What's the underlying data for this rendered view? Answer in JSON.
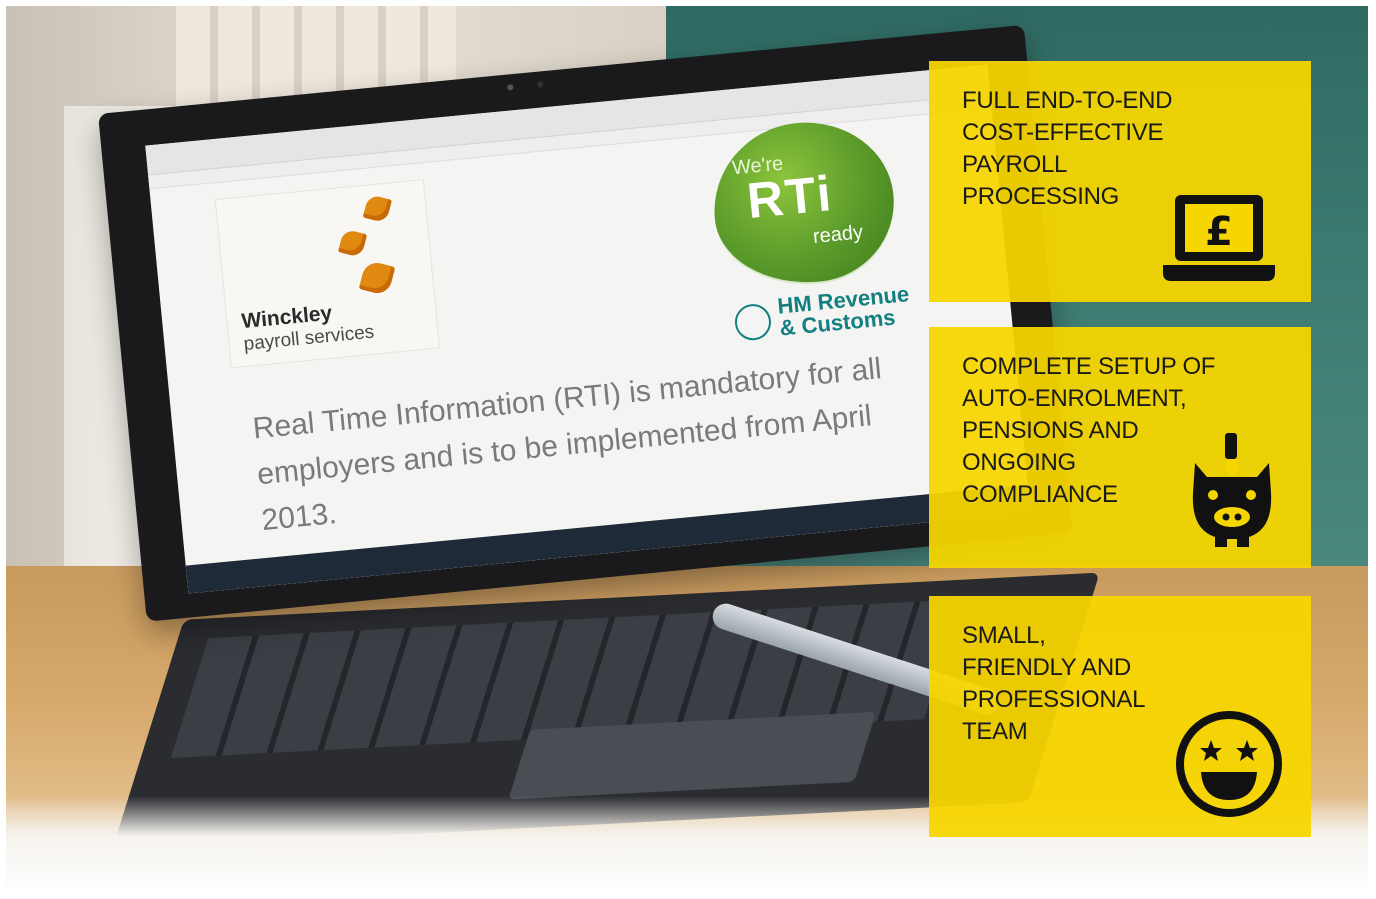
{
  "screen": {
    "brand_name": "Winckley",
    "brand_sub": "payroll services",
    "rti_were": "We're",
    "rti_big": "RTi",
    "rti_ready": "ready",
    "hmrc_line1": "HM Revenue",
    "hmrc_line2": "& Customs",
    "body_text": "Real Time Information (RTI) is mandatory for all employers and is to be implemented from April 2013."
  },
  "cards": [
    {
      "text": "FULL END-TO-END\nCOST-EFFECTIVE\nPAYROLL\nPROCESSING",
      "icon": "laptop-pound-icon"
    },
    {
      "text": "COMPLETE SETUP OF\nAUTO-ENROLMENT,\nPENSIONS AND\nONGOING\nCOMPLIANCE",
      "icon": "piggy-bank-icon"
    },
    {
      "text": "SMALL,\nFRIENDLY AND\nPROFESSIONAL\nTEAM",
      "icon": "happy-face-icon"
    }
  ],
  "colors": {
    "card_yellow": "#f6d600",
    "icon_black": "#111111",
    "hmrc_teal": "#128080",
    "rti_green": "#5a9a2a"
  }
}
